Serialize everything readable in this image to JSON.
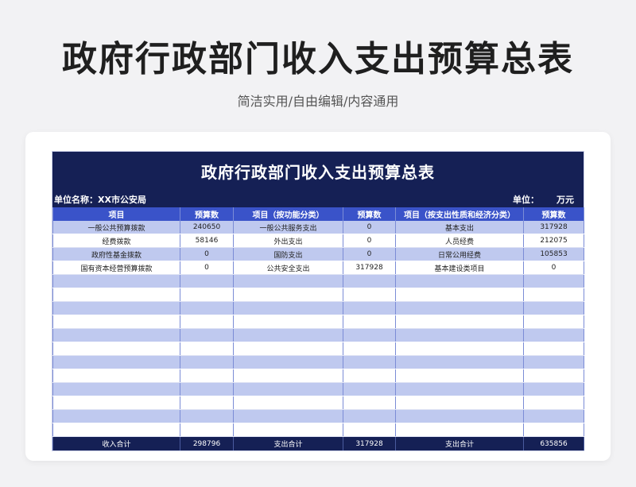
{
  "header": {
    "title": "政府行政部门收入支出预算总表",
    "subtitle": "简洁实用/自由编辑/内容通用"
  },
  "sheet": {
    "title": "政府行政部门收入支出预算总表",
    "unit_name_label": "单位名称：",
    "unit_name_value": "XX市公安局",
    "unit_label": "单位：",
    "unit_value": "万元",
    "columns": [
      "项目",
      "预算数",
      "项目（按功能分类）",
      "预算数",
      "项目（按支出性质和经济分类）",
      "预算数"
    ],
    "rows": [
      [
        "一般公共预算拨款",
        "240650",
        "一般公共服务支出",
        "0",
        "基本支出",
        "317928"
      ],
      [
        "经费拨款",
        "58146",
        "外出支出",
        "0",
        "人员经费",
        "212075"
      ],
      [
        "政府性基金拨款",
        "0",
        "国防支出",
        "0",
        "日常公用经费",
        "105853"
      ],
      [
        "国有资本经营预算拨款",
        "0",
        "公共安全支出",
        "317928",
        "基本建设类项目",
        "0"
      ]
    ],
    "empty_rows": 12,
    "totals": [
      "收入合计",
      "298796",
      "支出合计",
      "317928",
      "支出合计",
      "635856"
    ]
  },
  "colors": {
    "dark_navy": "#152055",
    "header_blue": "#3a53c9",
    "stripe_blue": "#bfc9ef"
  }
}
